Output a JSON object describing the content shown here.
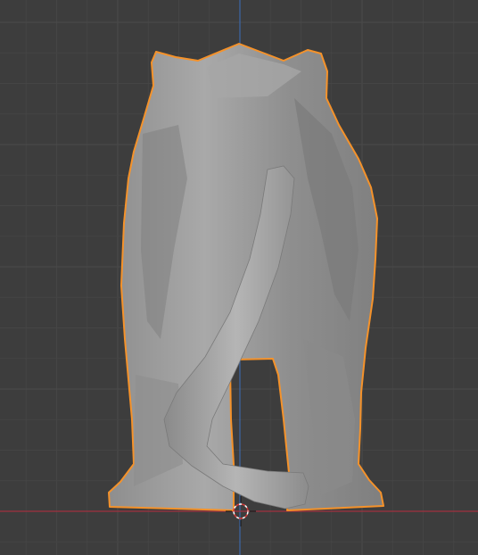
{
  "viewport": {
    "view": "back-orthographic",
    "background_color": "#3d3d3d",
    "grid_minor_color": "#454545",
    "grid_major_color": "#4a4a4a",
    "axis_x_color": "#a1313f",
    "axis_z_color": "#3d68a8",
    "selection_outline_color": "#f5922a",
    "mesh_color": "#9b9b9b",
    "mesh_shadow_color": "#7a7a7a",
    "mesh_highlight_color": "#b9b9b9"
  },
  "object": {
    "type": "sculpted-big-cat-model",
    "orientation": "rear-view",
    "selected": true
  },
  "cursor_3d": {
    "icon": "3d-cursor-icon"
  }
}
